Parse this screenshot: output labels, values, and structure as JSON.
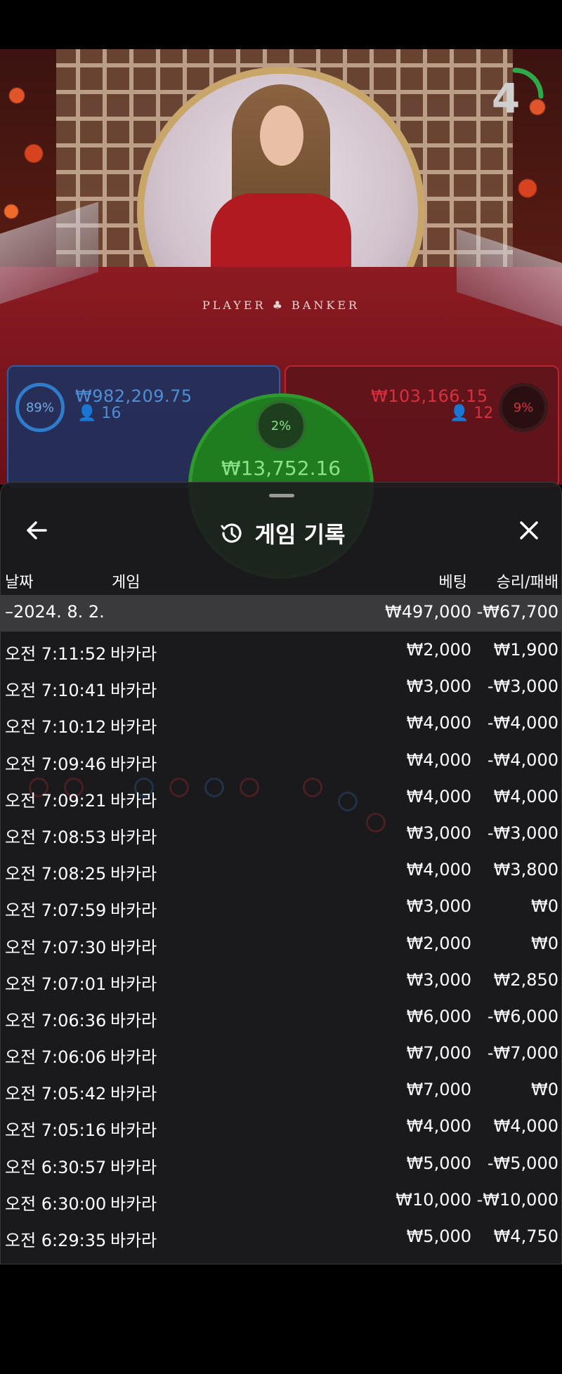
{
  "video": {
    "timer": "4",
    "table_label": "PLAYER ♣ BANKER"
  },
  "bets": {
    "player": {
      "percent": "89%",
      "amount": "₩982,209.75",
      "players": "16"
    },
    "banker": {
      "percent": "9%",
      "amount": "₩103,166.15",
      "players": "12"
    },
    "tie": {
      "percent": "2%",
      "amount": "₩13,752.16"
    }
  },
  "history": {
    "title": "게임 기록",
    "columns": {
      "date": "날짜",
      "game": "게임",
      "bet": "베팅",
      "result": "승리/패배"
    },
    "date_group": {
      "label": "–2024. 8. 2.",
      "bet": "₩497,000",
      "result": "-₩67,700"
    },
    "rows": [
      {
        "time": "오전 7:11:52",
        "game": "바카라",
        "bet": "₩2,000",
        "result": "₩1,900"
      },
      {
        "time": "오전 7:10:41",
        "game": "바카라",
        "bet": "₩3,000",
        "result": "-₩3,000"
      },
      {
        "time": "오전 7:10:12",
        "game": "바카라",
        "bet": "₩4,000",
        "result": "-₩4,000"
      },
      {
        "time": "오전 7:09:46",
        "game": "바카라",
        "bet": "₩4,000",
        "result": "-₩4,000"
      },
      {
        "time": "오전 7:09:21",
        "game": "바카라",
        "bet": "₩4,000",
        "result": "₩4,000"
      },
      {
        "time": "오전 7:08:53",
        "game": "바카라",
        "bet": "₩3,000",
        "result": "-₩3,000"
      },
      {
        "time": "오전 7:08:25",
        "game": "바카라",
        "bet": "₩4,000",
        "result": "₩3,800"
      },
      {
        "time": "오전 7:07:59",
        "game": "바카라",
        "bet": "₩3,000",
        "result": "₩0"
      },
      {
        "time": "오전 7:07:30",
        "game": "바카라",
        "bet": "₩2,000",
        "result": "₩0"
      },
      {
        "time": "오전 7:07:01",
        "game": "바카라",
        "bet": "₩3,000",
        "result": "₩2,850"
      },
      {
        "time": "오전 7:06:36",
        "game": "바카라",
        "bet": "₩6,000",
        "result": "-₩6,000"
      },
      {
        "time": "오전 7:06:06",
        "game": "바카라",
        "bet": "₩7,000",
        "result": "-₩7,000"
      },
      {
        "time": "오전 7:05:42",
        "game": "바카라",
        "bet": "₩7,000",
        "result": "₩0"
      },
      {
        "time": "오전 7:05:16",
        "game": "바카라",
        "bet": "₩4,000",
        "result": "₩4,000"
      },
      {
        "time": "오전 6:30:57",
        "game": "바카라",
        "bet": "₩5,000",
        "result": "-₩5,000"
      },
      {
        "time": "오전 6:30:00",
        "game": "바카라",
        "bet": "₩10,000",
        "result": "-₩10,000"
      },
      {
        "time": "오전 6:29:35",
        "game": "바카라",
        "bet": "₩5,000",
        "result": "₩4,750"
      }
    ]
  },
  "colors": {
    "player": "#2f7ccc",
    "banker": "#d8303c",
    "tie": "#2e9a2e",
    "sheet": "#1c1c1e",
    "date_row": "#3a3a3c"
  },
  "icons": {
    "back": "arrow-left-icon",
    "history": "history-clock-icon",
    "close": "close-icon",
    "user": "user-icon"
  }
}
